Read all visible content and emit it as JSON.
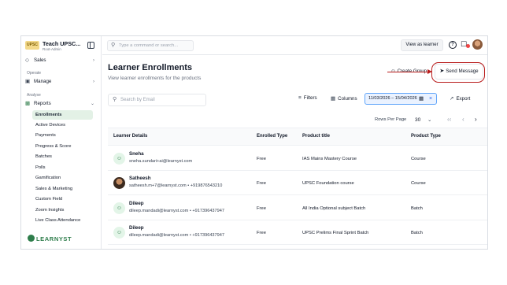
{
  "sidebar": {
    "org_title": "Teach UPSC...",
    "org_subtitle": "Root-Admin",
    "logo_text": "UPSC",
    "sales_label": "Sales",
    "operate_section": "Operate",
    "manage_label": "Manage",
    "analyse_section": "Analyse",
    "reports_label": "Reports",
    "report_items": [
      "Enrollments",
      "Active Devices",
      "Payments",
      "Progress & Score",
      "Batches",
      "Polls",
      "Gamification",
      "Sales & Marketing",
      "Custom Field",
      "Zoom Insights",
      "Live Class Attendance"
    ],
    "active_item": "Enrollments",
    "brand": "LEARNYST"
  },
  "topbar": {
    "search_placeholder": "Type a command or search...",
    "view_as_learner": "View as learner",
    "help_icon": "?"
  },
  "main": {
    "title": "Learner Enrollments",
    "subtitle": "View learner enrollments for the products",
    "create_group_label": "Create Group",
    "send_message_label": "Send Message",
    "search_placeholder": "Search by Email",
    "filters_label": "Filters",
    "columns_label": "Columns",
    "date_range": "11/03/2026 – 15/04/2026",
    "export_label": "Export",
    "rows_per_page_label": "Rows Per Page",
    "rows_per_page_value": "30"
  },
  "table": {
    "columns": [
      "Learner Details",
      "Enrolled Type",
      "Product title",
      "Product Type"
    ],
    "rows": [
      {
        "name": "Sneha",
        "email": "sneha.sundari+ai@learnyst.com",
        "enrolled_type": "Free",
        "product_title": "IAS Mains Mastery Course",
        "product_type": "Course"
      },
      {
        "name": "Satheesh",
        "email": "satheesh.m+7@learnyst.com  •  +919876543210",
        "enrolled_type": "Free",
        "product_title": "UPSC Foundation course",
        "product_type": "Course"
      },
      {
        "name": "Dileep",
        "email": "dileep.mandadi@learnyst.com  •  +917396437947",
        "enrolled_type": "Free",
        "product_title": "All India Optional subject Batch",
        "product_type": "Batch"
      },
      {
        "name": "Dileep",
        "email": "dileep.mandadi@learnyst.com  •  +917396437947",
        "enrolled_type": "Free",
        "product_title": "UPSC Prelims Final Sprint Batch",
        "product_type": "Batch"
      }
    ]
  },
  "colors": {
    "accent_green": "#2e7d4b",
    "active_bg": "#e3f1e6",
    "annotation_red": "#b91c1c",
    "date_border": "#60a5fa"
  },
  "icons": {
    "sidebar_toggle": "sidebar-toggle-icon",
    "sales": "tag-icon",
    "manage": "briefcase-icon",
    "reports": "bar-chart-icon",
    "search": "search-icon",
    "bell": "bell-icon",
    "filters": "sliders-icon",
    "columns": "columns-icon",
    "calendar": "calendar-icon",
    "export": "export-icon",
    "send": "send-icon",
    "group": "users-icon"
  }
}
